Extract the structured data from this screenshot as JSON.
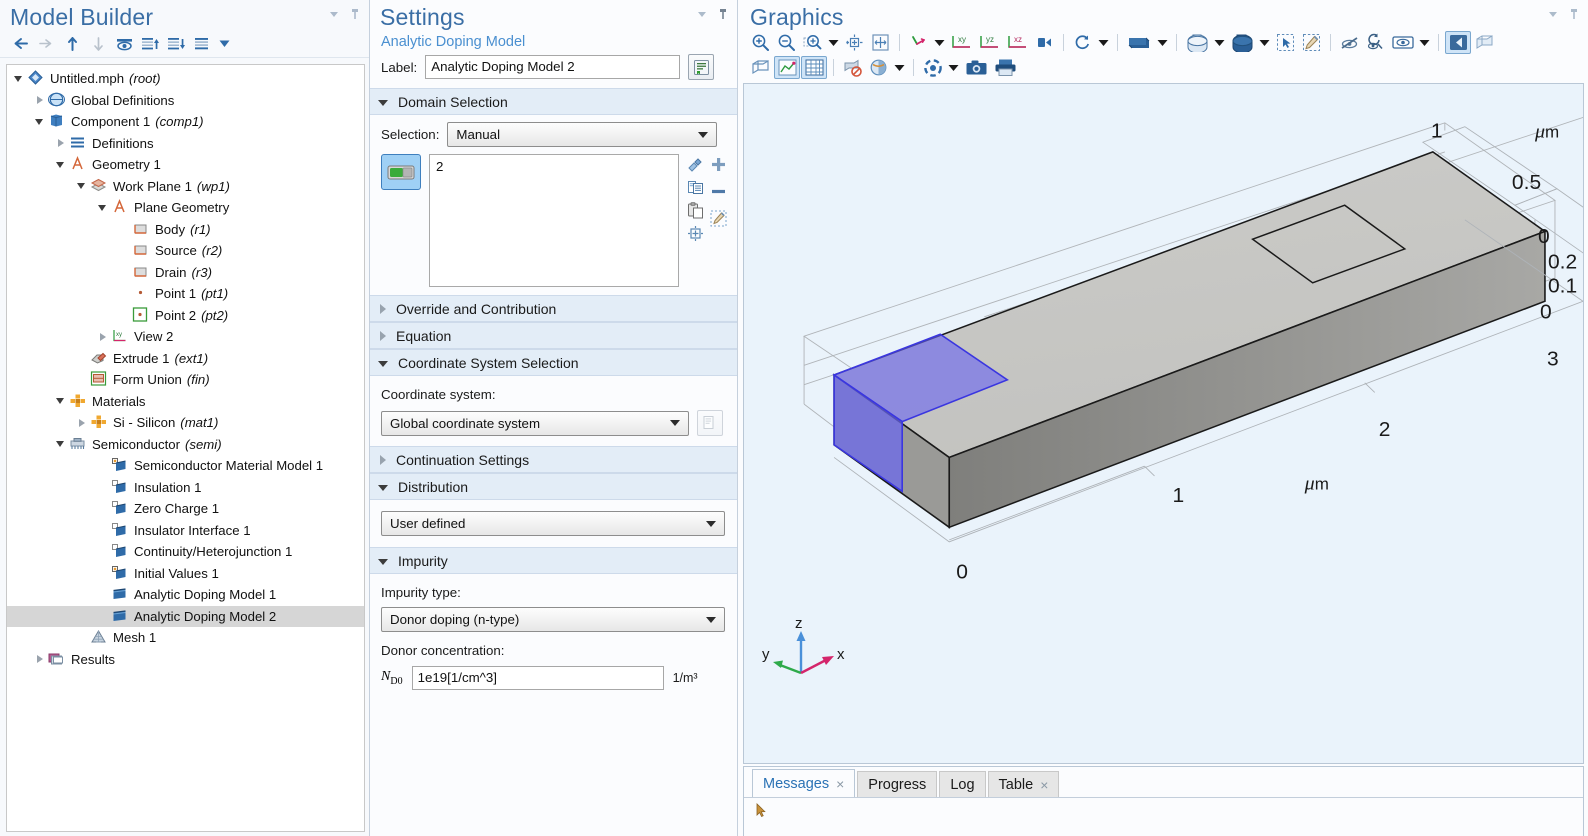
{
  "model_builder": {
    "title": "Model Builder",
    "toolbar": [
      {
        "name": "back-icon",
        "glyph": "←"
      },
      {
        "name": "forward-icon",
        "glyph": "→"
      },
      {
        "name": "move-up-icon",
        "glyph": "↑"
      },
      {
        "name": "move-down-icon",
        "glyph": "↓"
      },
      {
        "name": "show-hide-icon",
        "glyph": "eye"
      },
      {
        "name": "collapse-up-icon",
        "glyph": "list-up"
      },
      {
        "name": "expand-down-icon",
        "glyph": "list-down"
      },
      {
        "name": "model-tree-options-icon",
        "glyph": "list"
      },
      {
        "name": "tree-dropdown-icon",
        "glyph": "▼"
      }
    ],
    "tree": [
      {
        "indent": 0,
        "arrow": "open",
        "icon": "mph-root-icon",
        "label": "Untitled.mph",
        "tag": "(root)",
        "selected": false
      },
      {
        "indent": 1,
        "arrow": "closed",
        "icon": "globe-icon",
        "label": "Global Definitions",
        "tag": "",
        "selected": false
      },
      {
        "indent": 1,
        "arrow": "open",
        "icon": "component-icon",
        "label": "Component 1",
        "tag": "(comp1)",
        "selected": false
      },
      {
        "indent": 2,
        "arrow": "closed",
        "icon": "definitions-icon",
        "label": "Definitions",
        "tag": "",
        "selected": false
      },
      {
        "indent": 2,
        "arrow": "open",
        "icon": "geometry-icon",
        "label": "Geometry 1",
        "tag": "",
        "selected": false
      },
      {
        "indent": 3,
        "arrow": "open",
        "icon": "work-plane-icon",
        "label": "Work Plane 1",
        "tag": "(wp1)",
        "selected": false
      },
      {
        "indent": 4,
        "arrow": "open",
        "icon": "plane-geometry-icon",
        "label": "Plane Geometry",
        "tag": "",
        "selected": false
      },
      {
        "indent": 5,
        "arrow": "none",
        "icon": "rectangle-icon",
        "label": "Body",
        "tag": "(r1)",
        "selected": false
      },
      {
        "indent": 5,
        "arrow": "none",
        "icon": "rectangle-icon",
        "label": "Source",
        "tag": "(r2)",
        "selected": false
      },
      {
        "indent": 5,
        "arrow": "none",
        "icon": "rectangle-icon",
        "label": "Drain",
        "tag": "(r3)",
        "selected": false
      },
      {
        "indent": 5,
        "arrow": "none",
        "icon": "point-icon",
        "label": "Point 1",
        "tag": "(pt1)",
        "selected": false
      },
      {
        "indent": 5,
        "arrow": "none",
        "icon": "point-active-icon",
        "label": "Point 2",
        "tag": "(pt2)",
        "selected": false
      },
      {
        "indent": 4,
        "arrow": "closed",
        "icon": "view-xy-icon",
        "label": "View 2",
        "tag": "",
        "selected": false
      },
      {
        "indent": 3,
        "arrow": "none",
        "icon": "extrude-icon",
        "label": "Extrude 1",
        "tag": "(ext1)",
        "selected": false
      },
      {
        "indent": 3,
        "arrow": "none",
        "icon": "form-union-icon",
        "label": "Form Union",
        "tag": "(fin)",
        "selected": false
      },
      {
        "indent": 2,
        "arrow": "open",
        "icon": "materials-icon",
        "label": "Materials",
        "tag": "",
        "selected": false
      },
      {
        "indent": 3,
        "arrow": "closed",
        "icon": "material-icon",
        "label": "Si - Silicon",
        "tag": "(mat1)",
        "selected": false
      },
      {
        "indent": 2,
        "arrow": "open",
        "icon": "semiconductor-icon",
        "label": "Semiconductor",
        "tag": "(semi)",
        "selected": false
      },
      {
        "indent": 4,
        "arrow": "none",
        "icon": "domain-node-icon",
        "label": "Semiconductor Material Model 1",
        "tag": "",
        "selected": false
      },
      {
        "indent": 4,
        "arrow": "none",
        "icon": "boundary-node-icon",
        "label": "Insulation 1",
        "tag": "",
        "selected": false
      },
      {
        "indent": 4,
        "arrow": "none",
        "icon": "boundary-node-icon",
        "label": "Zero Charge 1",
        "tag": "",
        "selected": false
      },
      {
        "indent": 4,
        "arrow": "none",
        "icon": "boundary-node-icon",
        "label": "Insulator Interface 1",
        "tag": "",
        "selected": false
      },
      {
        "indent": 4,
        "arrow": "none",
        "icon": "boundary-node-icon",
        "label": "Continuity/Heterojunction 1",
        "tag": "",
        "selected": false
      },
      {
        "indent": 4,
        "arrow": "none",
        "icon": "domain-node-icon",
        "label": "Initial Values 1",
        "tag": "",
        "selected": false
      },
      {
        "indent": 4,
        "arrow": "none",
        "icon": "doping-icon",
        "label": "Analytic Doping Model 1",
        "tag": "",
        "selected": false
      },
      {
        "indent": 4,
        "arrow": "none",
        "icon": "doping-icon",
        "label": "Analytic Doping Model 2",
        "tag": "",
        "selected": true
      },
      {
        "indent": 3,
        "arrow": "none",
        "icon": "mesh-icon",
        "label": "Mesh 1",
        "tag": "",
        "selected": false
      },
      {
        "indent": 1,
        "arrow": "closed",
        "icon": "results-icon",
        "label": "Results",
        "tag": "",
        "selected": false
      }
    ]
  },
  "settings": {
    "title": "Settings",
    "subtitle": "Analytic Doping Model",
    "label_caption": "Label:",
    "label_value": "Analytic Doping Model 2",
    "label_note_icon": "description-note-icon",
    "domain_selection": {
      "header": "Domain Selection",
      "expanded": true,
      "selection_caption": "Selection:",
      "selection_value": "Manual",
      "toggle_icon": "active-toggle-icon",
      "list_entries": [
        "2"
      ],
      "side_buttons": [
        {
          "name": "paste-selection-icon",
          "glyph": "paste-sel"
        },
        {
          "name": "copy-selection-icon",
          "glyph": "copy-sel"
        },
        {
          "name": "paste-icon",
          "glyph": "clipboard"
        },
        {
          "name": "zoom-to-selection-icon",
          "glyph": "zoom-sel"
        }
      ],
      "right_buttons": [
        {
          "name": "add-to-selection-button",
          "glyph": "+"
        },
        {
          "name": "remove-from-selection-button",
          "glyph": "−"
        },
        {
          "name": "clear-selection-button",
          "glyph": "broom"
        }
      ]
    },
    "override_and_contribution": {
      "header": "Override and Contribution",
      "expanded": false
    },
    "equation": {
      "header": "Equation",
      "expanded": false
    },
    "coordinate_system_selection": {
      "header": "Coordinate System Selection",
      "expanded": true,
      "caption": "Coordinate system:",
      "value": "Global coordinate system",
      "side_button_icon": "create-coordinate-system-icon"
    },
    "continuation_settings": {
      "header": "Continuation Settings",
      "expanded": false
    },
    "distribution": {
      "header": "Distribution",
      "expanded": true,
      "value": "User defined"
    },
    "impurity": {
      "header": "Impurity",
      "expanded": true,
      "type_caption": "Impurity type:",
      "type_value": "Donor doping (n-type)",
      "concentration_caption": "Donor concentration:",
      "symbol_main": "N",
      "symbol_sub": "D0",
      "concentration_value": "1e19[1/cm^3]",
      "unit": "1/m³"
    }
  },
  "graphics": {
    "title": "Graphics",
    "toolbar_row1": [
      {
        "name": "zoom-in-icon"
      },
      {
        "name": "zoom-out-icon"
      },
      {
        "name": "zoom-box-icon"
      },
      {
        "name": "zoom-dropdown-icon"
      },
      {
        "name": "zoom-extents-icon"
      },
      {
        "name": "zoom-to-fit-icon"
      },
      {
        "name": "go-to-default-view-icon"
      },
      {
        "name": "view-dropdown-icon"
      },
      {
        "name": "go-to-xy-view-icon"
      },
      {
        "name": "go-to-yz-view-icon"
      },
      {
        "name": "go-to-xz-view-icon"
      },
      {
        "name": "camera-view-icon"
      },
      {
        "name": "orbit-rotate-icon"
      },
      {
        "name": "orbit-dropdown-icon"
      },
      {
        "name": "transparency-icon"
      },
      {
        "name": "transparency-dropdown-icon"
      },
      {
        "name": "wireframe-rendering-icon"
      },
      {
        "name": "wireframe-dropdown-icon"
      },
      {
        "name": "select-all-icon"
      },
      {
        "name": "clear-selection-icon"
      },
      {
        "name": "hide-geometry-icon"
      },
      {
        "name": "reset-hiding-icon"
      },
      {
        "name": "view-hidden-icon"
      },
      {
        "name": "view-hidden-dropdown-icon"
      },
      {
        "name": "show-grid-icon"
      },
      {
        "name": "show-bounding-box-icon"
      }
    ],
    "toolbar_row2": [
      {
        "name": "scene-light-icon"
      },
      {
        "name": "plot-data-icon"
      },
      {
        "name": "grid-table-icon"
      },
      {
        "name": "hide-selected-icon"
      },
      {
        "name": "transparency-ball-icon"
      },
      {
        "name": "transparency-ball-dropdown-icon"
      },
      {
        "name": "select-color-icon"
      },
      {
        "name": "select-color-dropdown-icon"
      },
      {
        "name": "snapshot-icon"
      },
      {
        "name": "print-icon"
      }
    ],
    "axis_triad": {
      "x": "x",
      "y": "y",
      "z": "z"
    },
    "axis_ticks": {
      "top_right": [
        "1",
        "0.5"
      ],
      "unit_top": "μm",
      "right_vertical": [
        "0",
        "0.2",
        "0.1",
        "0"
      ],
      "right_depth": "3",
      "bottom": [
        "0",
        "1",
        "2"
      ],
      "unit_bottom": "μm"
    },
    "selected_face_color": "#6a66f0"
  },
  "bottom_panel": {
    "tabs": [
      {
        "label": "Messages",
        "active": true,
        "closable": true
      },
      {
        "label": "Progress",
        "active": false,
        "closable": false
      },
      {
        "label": "Log",
        "active": false,
        "closable": false
      },
      {
        "label": "Table",
        "active": false,
        "closable": true
      }
    ]
  },
  "colors": {
    "accent_blue": "#3a6ea5",
    "section_header_bg": "#e3edf7",
    "panel_bg": "#fbfcfe",
    "canvas_bg": "#eaf3fb",
    "selection_highlight": "#d6d6d6",
    "geometry_top": "#c9c9c6",
    "geometry_side": "#8f8f8c"
  }
}
